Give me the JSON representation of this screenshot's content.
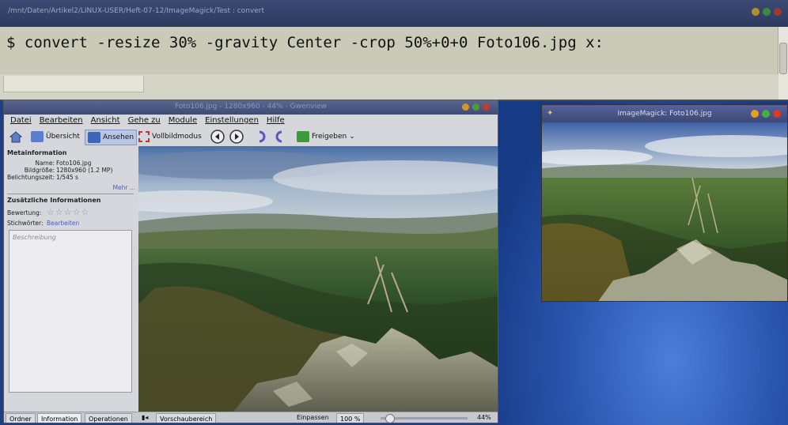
{
  "terminal": {
    "title": "/mnt/Daten/Artikel2/LINUX-USER/Heft-07-12/ImageMagick/Test : convert",
    "command": "$ convert -resize 30% -gravity Center -crop 50%+0+0 Foto106.jpg x:"
  },
  "gwenview": {
    "title": "Foto106.jpg - 1280x960 - 44% - Gwenview",
    "menu": [
      "Datei",
      "Bearbeiten",
      "Ansicht",
      "Gehe zu",
      "Module",
      "Einstellungen",
      "Hilfe"
    ],
    "toolbar": {
      "overview": "Übersicht",
      "view": "Ansehen",
      "fullscreen": "Vollbildmodus",
      "share": "Freigeben"
    },
    "sidebar": {
      "meta_heading": "Metainformation",
      "name_label": "Name:",
      "name_value": "Foto106.jpg",
      "size_label": "Bildgröße:",
      "size_value": "1280x960 (1.2 MP)",
      "exposure_label": "Belichtungszeit:",
      "exposure_value": "1/545 s",
      "more": "Mehr ...",
      "extra_heading": "Zusätzliche Informationen",
      "rating_label": "Bewertung:",
      "keywords_label": "Stichwörter:",
      "keywords_link": "Bearbeiten",
      "description_placeholder": "Beschreibung"
    },
    "statusbar": {
      "tab_folders": "Ordner",
      "tab_info": "Information",
      "tab_operations": "Operationen",
      "preview": "Vorschaubereich",
      "fit": "Einpassen",
      "zoom100": "100 %",
      "zoom": "44%",
      "zoom_slider_level": 0.1
    }
  },
  "imagemagick": {
    "title": "ImageMagick: Foto106.jpg"
  },
  "colors": {
    "close": "#e04030",
    "minimize": "#e0a020",
    "maximize": "#50b030"
  }
}
